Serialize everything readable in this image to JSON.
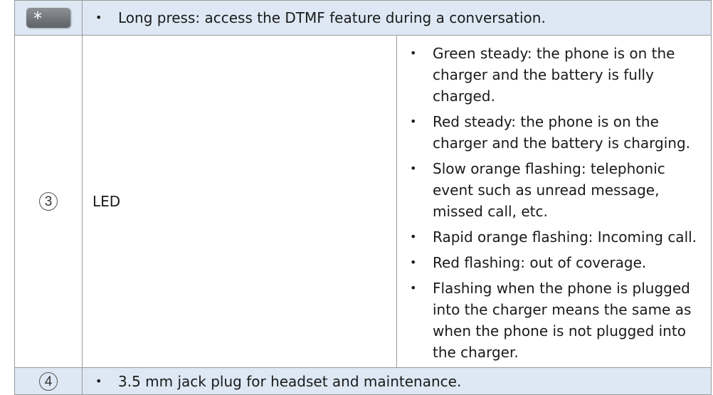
{
  "rows": [
    {
      "key_icon": "*",
      "bullets": [
        "Long press: access the DTMF feature during a conversation."
      ]
    },
    {
      "number": "3",
      "label": "LED",
      "bullets": [
        "Green steady: the phone is on the charger and the battery is fully charged.",
        "Red steady: the phone is on the charger and the battery is charging.",
        "Slow orange flashing: telephonic event such as unread message, missed call, etc.",
        "Rapid orange flashing: Incoming call.",
        "Red flashing: out of coverage.",
        "Flashing when the phone is plugged into the charger means the same as when the phone is not plugged into the charger."
      ]
    },
    {
      "number": "4",
      "bullets": [
        "3.5 mm jack plug for headset and maintenance."
      ]
    }
  ],
  "bullet_glyph": "•",
  "colors": {
    "shaded_row": "#dde8f4",
    "border": "#9a9a9a",
    "key_button": "#73777c"
  }
}
